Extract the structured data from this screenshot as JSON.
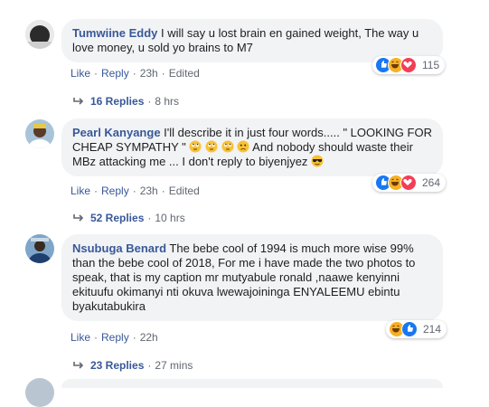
{
  "comments": [
    {
      "name": "Tumwiine Eddy",
      "text": "I will say u lost brain en gained weight, The way u love money, u sold yo brains to M7",
      "actions": {
        "like": "Like",
        "reply": "Reply",
        "time": "23h",
        "edited": "Edited"
      },
      "reaction_count": "115",
      "reaction_icons": [
        "like-icon",
        "haha-icon",
        "love-icon"
      ],
      "replies": {
        "label": "16 Replies",
        "time": "8 hrs"
      }
    },
    {
      "name": "Pearl Kanyange",
      "text_part1": "I'll describe it in just four words..... \" LOOKING FOR CHEAP SYMPATHY \"",
      "text_part2": "And nobody should waste their MBz attacking me ... I don't reply to biyenjyez",
      "inline_emojis": [
        "face-with-rolling-eyes",
        "face-with-rolling-eyes",
        "face-with-rolling-eyes",
        "frowning-face",
        "sunglasses-face"
      ],
      "actions": {
        "like": "Like",
        "reply": "Reply",
        "time": "23h",
        "edited": "Edited"
      },
      "reaction_count": "264",
      "reaction_icons": [
        "like-icon",
        "haha-icon",
        "love-icon"
      ],
      "replies": {
        "label": "52 Replies",
        "time": "10 hrs"
      }
    },
    {
      "name": "Nsubuga Benard",
      "text": "The bebe cool of 1994 is much more wise 99% than the bebe cool of 2018, For me i have made the two photos to speak, that is my caption mr mutyabule ronald ,naawe kenyinni ekituufu okimanyi nti okuva lwewajoininga ENYALEEMU ebintu byakutabukira",
      "actions": {
        "like": "Like",
        "reply": "Reply",
        "time": "22h"
      },
      "reaction_count": "214",
      "reaction_icons": [
        "haha-icon",
        "like-icon"
      ],
      "replies": {
        "label": "23 Replies",
        "time": "27 mins"
      }
    }
  ],
  "colors": {
    "link": "#385898",
    "bubble": "#f2f3f5",
    "meta": "#606770",
    "like": "#1877f2",
    "haha": "#f7b125",
    "love": "#f33e58"
  }
}
